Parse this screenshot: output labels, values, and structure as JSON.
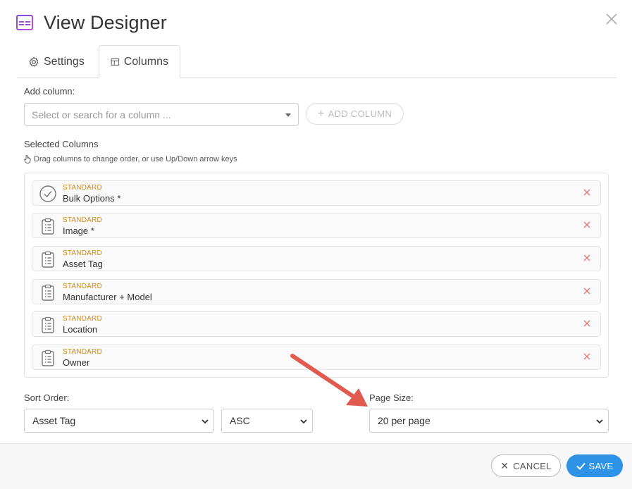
{
  "dialog": {
    "title": "View Designer",
    "icons": {
      "app": "view-designer-icon",
      "close": "close-icon"
    }
  },
  "tabs": [
    {
      "label": "Settings",
      "icon": "gear-icon",
      "active": false
    },
    {
      "label": "Columns",
      "icon": "columns-icon",
      "active": true
    }
  ],
  "add_column": {
    "label": "Add column:",
    "placeholder": "Select or search for a column ...",
    "button_label": "ADD COLUMN"
  },
  "selected": {
    "title": "Selected Columns",
    "hint": "Drag columns to change order, or use Up/Down arrow keys",
    "items": [
      {
        "type": "STANDARD",
        "name": "Bulk Options *",
        "icon": "check-circle-icon"
      },
      {
        "type": "STANDARD",
        "name": "Image *",
        "icon": "clipboard-icon"
      },
      {
        "type": "STANDARD",
        "name": "Asset Tag",
        "icon": "clipboard-icon"
      },
      {
        "type": "STANDARD",
        "name": "Manufacturer + Model",
        "icon": "clipboard-icon"
      },
      {
        "type": "STANDARD",
        "name": "Location",
        "icon": "clipboard-icon"
      },
      {
        "type": "STANDARD",
        "name": "Owner",
        "icon": "clipboard-icon"
      }
    ]
  },
  "sort": {
    "label": "Sort Order:",
    "field_value": "Asset Tag",
    "direction_value": "ASC"
  },
  "page_size": {
    "label": "Page Size:",
    "value": "20 per page"
  },
  "footer": {
    "cancel_label": "CANCEL",
    "save_label": "SAVE"
  },
  "colors": {
    "accent": "#2e93e6",
    "tag": "#d08a12",
    "remove": "#e57373",
    "annotation_arrow": "#e05a50"
  }
}
